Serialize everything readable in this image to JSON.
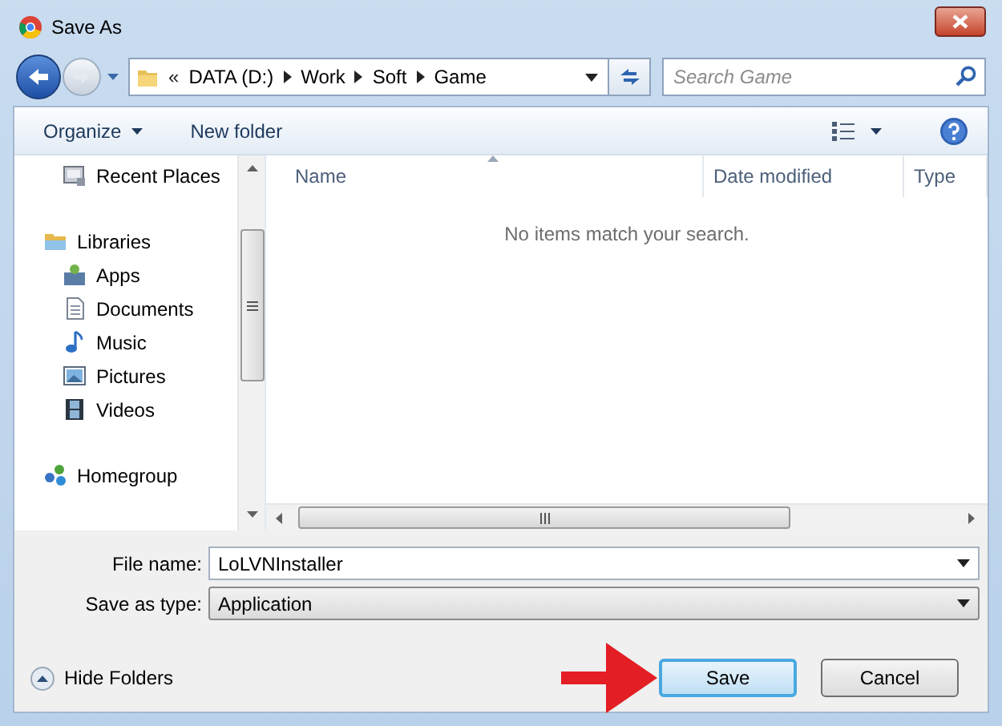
{
  "window": {
    "title": "Save As"
  },
  "address": {
    "overflow": "«",
    "segments": [
      "DATA (D:)",
      "Work",
      "Soft",
      "Game"
    ]
  },
  "search": {
    "placeholder": "Search Game"
  },
  "toolbar": {
    "organize": "Organize",
    "new_folder": "New folder"
  },
  "nav": {
    "favorites_items": [
      {
        "label": "Recent Places",
        "kind": "recent"
      }
    ],
    "tree": [
      {
        "label": "Libraries",
        "kind": "library",
        "children": [
          {
            "label": "Apps",
            "kind": "apps"
          },
          {
            "label": "Documents",
            "kind": "documents"
          },
          {
            "label": "Music",
            "kind": "music"
          },
          {
            "label": "Pictures",
            "kind": "pictures"
          },
          {
            "label": "Videos",
            "kind": "videos"
          }
        ]
      },
      {
        "label": "Homegroup",
        "kind": "homegroup"
      }
    ]
  },
  "columns": [
    {
      "label": "Name",
      "sorted": true
    },
    {
      "label": "Date modified",
      "sorted": false
    },
    {
      "label": "Type",
      "sorted": false
    }
  ],
  "empty_message": "No items match your search.",
  "file_name": {
    "label": "File name:",
    "value": "LoLVNInstaller"
  },
  "save_type": {
    "label": "Save as type:",
    "value": "Application"
  },
  "hide_folders": "Hide Folders",
  "buttons": [
    {
      "label": "Save",
      "default": true
    },
    {
      "label": "Cancel",
      "default": false
    }
  ]
}
